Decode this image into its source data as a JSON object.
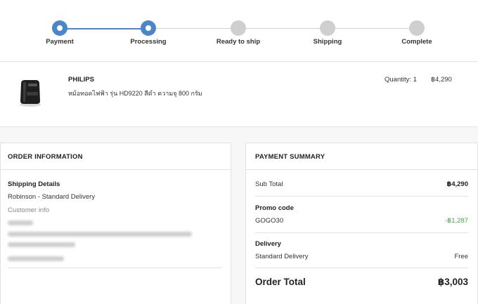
{
  "steps": [
    {
      "label": "Payment",
      "status": "done"
    },
    {
      "label": "Processing",
      "status": "done"
    },
    {
      "label": "Ready to ship",
      "status": "pending"
    },
    {
      "label": "Shipping",
      "status": "pending"
    },
    {
      "label": "Complete",
      "status": "pending"
    }
  ],
  "product": {
    "brand": "PHILIPS",
    "name": "หม้อทอดไฟฟ้า รุ่น HD9220 สีดำ ความจุ 800 กรัม",
    "quantity": "Quantity: 1",
    "price": "฿4,290"
  },
  "order_info": {
    "title": "ORDER INFORMATION",
    "shipping_label": "Shipping Details",
    "shipping_value": "Robinson - Standard Delivery",
    "customer_label": "Customer info"
  },
  "payment_summary": {
    "title": "PAYMENT SUMMARY",
    "subtotal_label": "Sub Total",
    "subtotal_value": "฿4,290",
    "promo_label": "Promo code",
    "promo_code": "GOGO30",
    "promo_value": "-฿1,287",
    "delivery_label": "Delivery",
    "delivery_method": "Standard Delivery",
    "delivery_value": "Free",
    "total_label": "Order Total",
    "total_value": "฿3,003"
  },
  "colors": {
    "accent": "#4a86c8",
    "inactive": "#cfcfcf",
    "discount": "#45a245"
  },
  "icons": {
    "product": "air-fryer-image"
  }
}
